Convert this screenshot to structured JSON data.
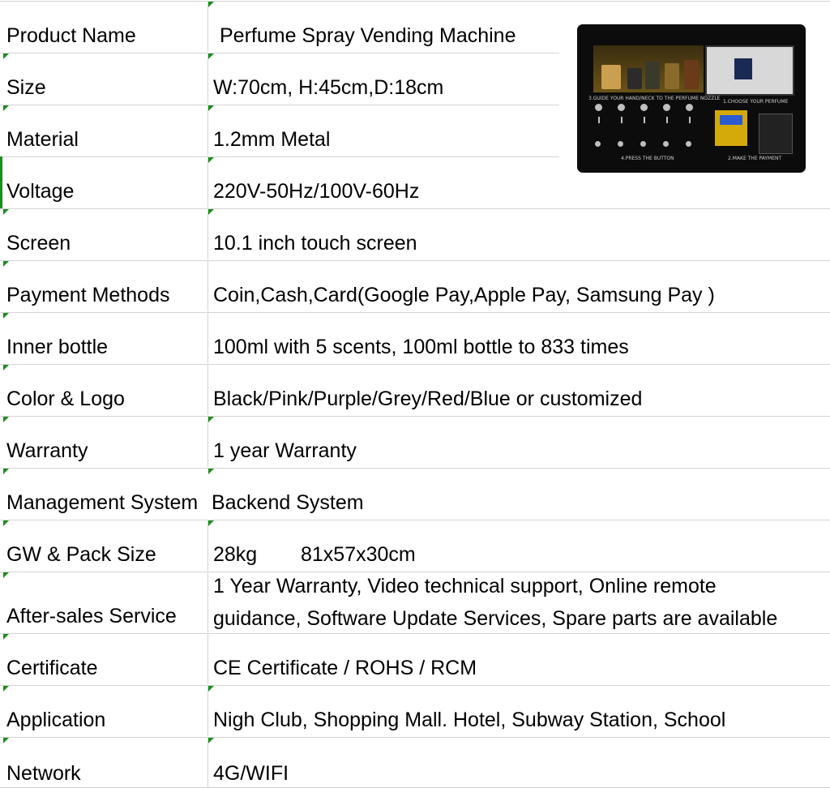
{
  "rows": [
    {
      "label": "Product Name",
      "value": "Perfume Spray Vending Machine"
    },
    {
      "label": "Size",
      "value": "W:70cm, H:45cm,D:18cm"
    },
    {
      "label": "Material",
      "value": "1.2mm Metal"
    },
    {
      "label": "Voltage",
      "value": "220V-50Hz/100V-60Hz"
    },
    {
      "label": "Screen",
      "value": "10.1 inch touch screen"
    },
    {
      "label": "Payment Methods",
      "value": "Coin,Cash,Card(Google Pay,Apple Pay, Samsung Pay )"
    },
    {
      "label": "Inner bottle",
      "value": "100ml with 5 scents, 100ml bottle to 833 times"
    },
    {
      "label": "Color & Logo",
      "value": "Black/Pink/Purple/Grey/Red/Blue or customized"
    },
    {
      "label": "Warranty",
      "value": "1 year Warranty"
    },
    {
      "label": "Management System",
      "value": "Backend System"
    },
    {
      "label": "GW & Pack Size",
      "value": "28kg",
      "value2": "81x57x30cm"
    },
    {
      "label": "After-sales Service",
      "value": "1 Year Warranty, Video technical support, Online remote",
      "value2": "guidance, Software Update Services, Spare parts are available"
    },
    {
      "label": "Certificate",
      "value": "CE Certificate / ROHS / RCM"
    },
    {
      "label": "Application",
      "value": "Nigh Club, Shopping Mall. Hotel, Subway Station, School"
    },
    {
      "label": "Network",
      "value": "4G/WIFI"
    }
  ],
  "machine_image": {
    "step1": "1.CHOOSE YOUR PERFUME",
    "step2": "2.MAKE THE PAYMENT",
    "step3": "3.GUIDE YOUR HAND/NECK TO THE PERFUME NOZZLE",
    "step4": "4.PRESS THE BUTTON",
    "colors": {
      "body": "#0c0c0c",
      "accent": "#d4a90a",
      "grid_marker": "#1e8c1e"
    }
  }
}
